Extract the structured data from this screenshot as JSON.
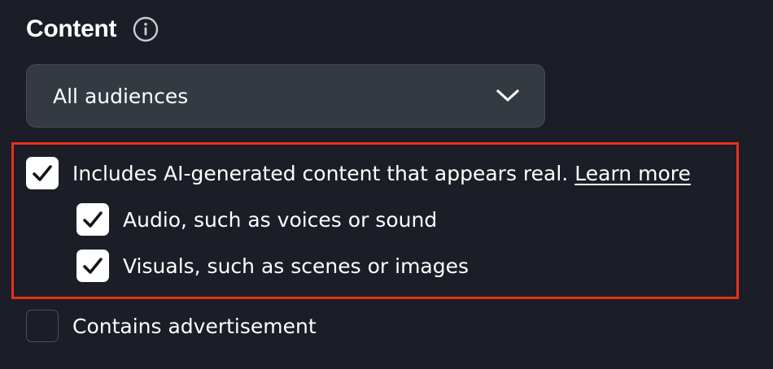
{
  "section": {
    "title": "Content",
    "info_icon": "info-icon"
  },
  "audience_select": {
    "selected": "All audiences",
    "icon": "chevron-down-icon"
  },
  "ai_disclosure": {
    "label": "Includes AI-generated content that appears real.",
    "learn_more": "Learn more",
    "checked": true,
    "suboptions": [
      {
        "label": "Audio, such as voices or sound",
        "checked": true
      },
      {
        "label": "Visuals, such as scenes or images",
        "checked": true
      }
    ]
  },
  "advertisement": {
    "label": "Contains advertisement",
    "checked": false
  },
  "colors": {
    "background": "#1b1e26",
    "dropdown": "#343a42",
    "highlight": "#e8301c",
    "checkbox_checked": "#ffffff"
  }
}
